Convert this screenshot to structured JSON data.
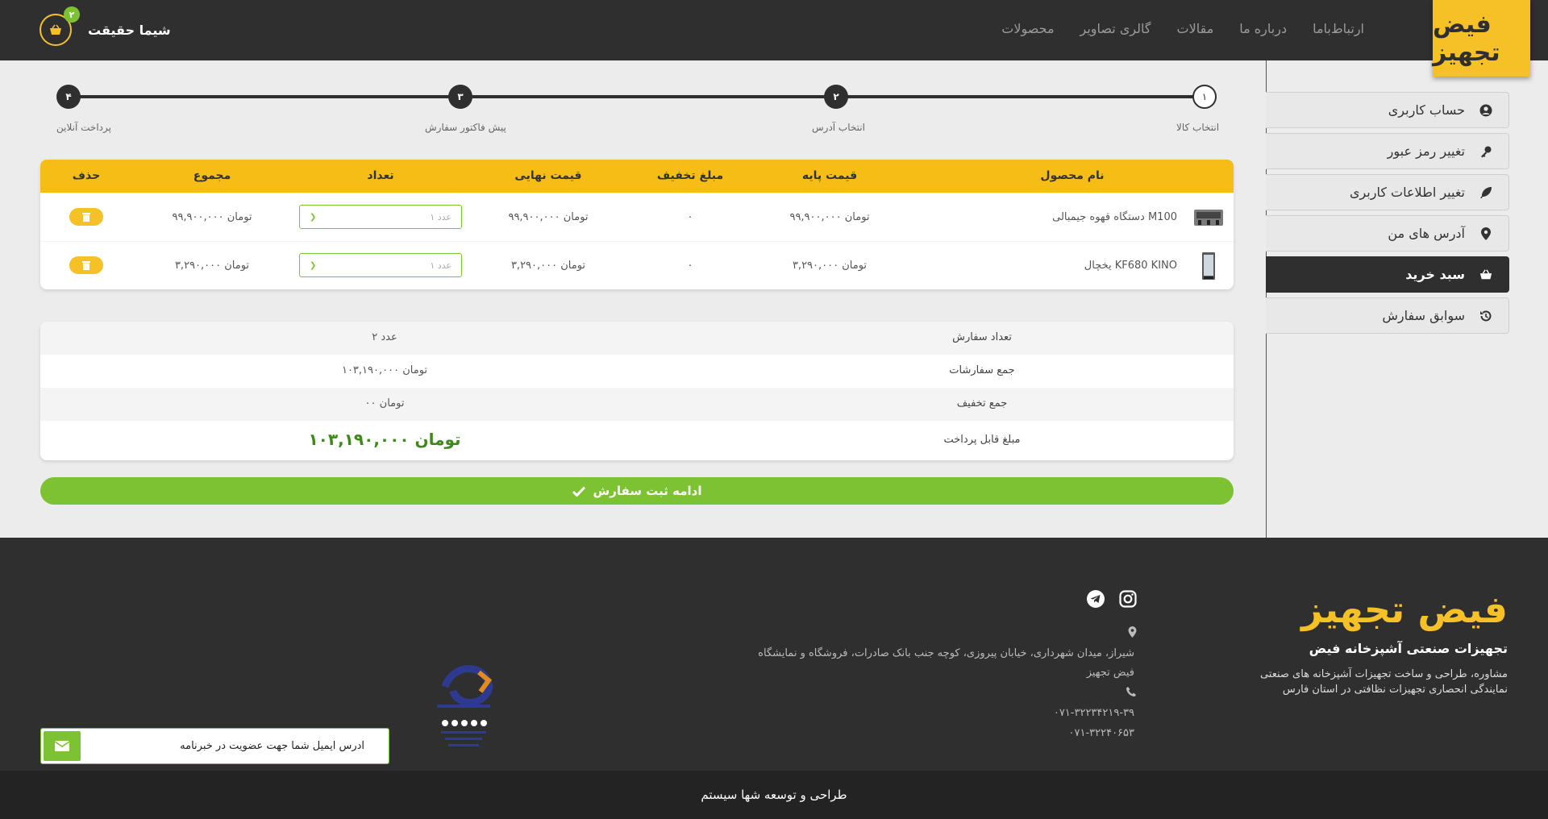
{
  "header": {
    "logo_text": "فیض تجهیز",
    "nav": [
      "محصولات",
      "گالری تصاویر",
      "مقالات",
      "درباره ما",
      "ارتباط‌باما"
    ],
    "user_name": "شیما حقیقت",
    "cart_count": "۲"
  },
  "sidebar": {
    "items": [
      {
        "label": "حساب کاربری",
        "icon": "user-circle-icon"
      },
      {
        "label": "تغییر رمز عبور",
        "icon": "key-icon"
      },
      {
        "label": "تغییر اطلاعات کاربری",
        "icon": "feather-icon"
      },
      {
        "label": "آدرس های من",
        "icon": "map-marker-icon"
      },
      {
        "label": "سبد خرید",
        "icon": "basket-icon",
        "active": true
      },
      {
        "label": "سوابق سفارش",
        "icon": "history-icon"
      }
    ]
  },
  "steps": [
    {
      "num": "۱",
      "label": "انتخاب کالا"
    },
    {
      "num": "۲",
      "label": "انتخاب آدرس"
    },
    {
      "num": "۳",
      "label": "پیش فاکتور سفارش"
    },
    {
      "num": "۴",
      "label": "پرداخت آنلاین"
    }
  ],
  "cart_table": {
    "headers": {
      "name": "نام محصول",
      "base_price": "قیمت پایه",
      "discount": "مبلغ تخفیف",
      "final_price": "قیمت نهایی",
      "quantity": "تعداد",
      "total": "مجموع",
      "delete": "حذف"
    },
    "rows": [
      {
        "name": "دستگاه قهوه جیمبالی M100",
        "base_price": "۹۹,۹۰۰,۰۰۰ تومان",
        "discount": "۰",
        "final_price": "۹۹,۹۰۰,۰۰۰ تومان",
        "quantity": "۱ عدد",
        "total": "۹۹,۹۰۰,۰۰۰ تومان"
      },
      {
        "name": "یخچال KF680 KINO",
        "base_price": "۳,۲۹۰,۰۰۰ تومان",
        "discount": "۰",
        "final_price": "۳,۲۹۰,۰۰۰ تومان",
        "quantity": "۱ عدد",
        "total": "۳,۲۹۰,۰۰۰ تومان"
      }
    ]
  },
  "summary": {
    "count_label": "تعداد سفارش",
    "count_value": "۲ عدد",
    "orders_total_label": "جمع سفارشات",
    "orders_total_value": "۱۰۳,۱۹۰,۰۰۰ تومان",
    "discount_label": "جمع تخفیف",
    "discount_value": "۰۰ تومان",
    "payable_label": "مبلغ قابل پرداخت",
    "payable_value": "۱۰۳,۱۹۰,۰۰۰ تومان"
  },
  "continue_label": "ادامه ثبت سفارش",
  "footer": {
    "logo_text": "فیض تجهیز",
    "title": "تجهیزات صنعتی آشپزخانه فیض",
    "desc_line1": "مشاوره، طراحی و ساخت تجهیزات آشپزخانه های صنعتی",
    "desc_line2": "نمایندگی انحصاری تجهیزات نظافتی در استان فارس",
    "address_line1": "شیراز، میدان شهرداری، خیابان پیروزی، کوچه جنب بانک صادرات، فروشگاه و نمایشگاه",
    "address_line2": "فیض تجهیز",
    "phone1": "۰۷۱-۳۲۲۳۴۲۱۹-۳۹",
    "phone2": "۰۷۱-۳۲۲۴۰۶۵۳",
    "newsletter_placeholder": "آدرس ایمیل شما جهت عضویت در خبرنامه",
    "credit": "طراحی و توسعه شها سیستم"
  },
  "colors": {
    "accent": "#f5c127",
    "dark": "#2f2f2f",
    "green": "#7dc233"
  }
}
